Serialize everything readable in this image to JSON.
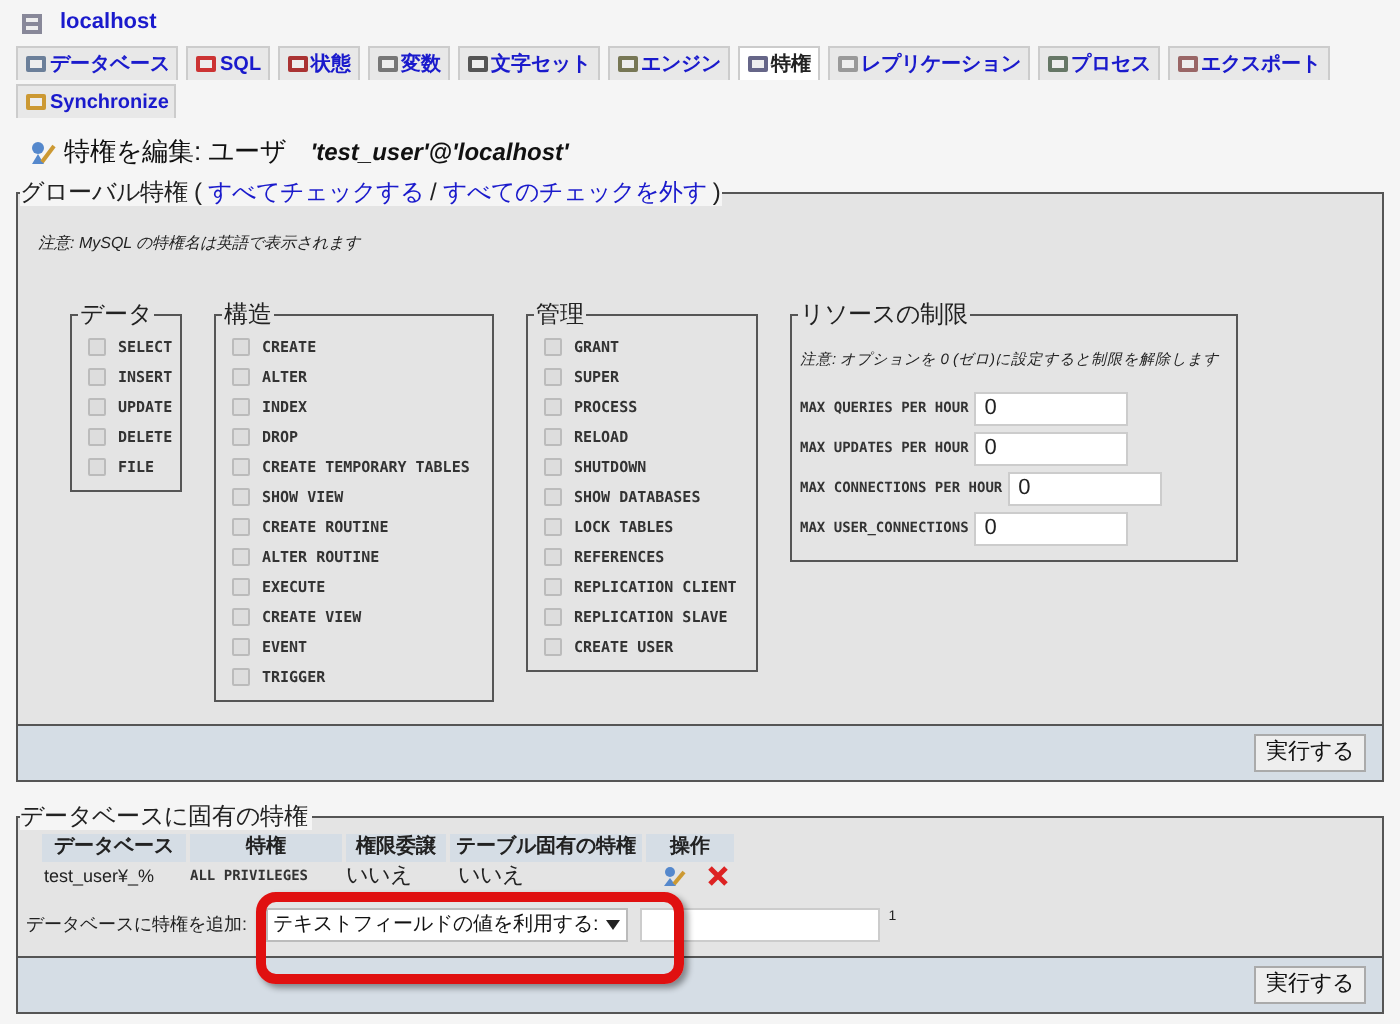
{
  "server": {
    "title": "localhost"
  },
  "tabs": [
    {
      "label": "データベース",
      "selected": false
    },
    {
      "label": "SQL",
      "selected": false
    },
    {
      "label": "状態",
      "selected": false
    },
    {
      "label": "変数",
      "selected": false
    },
    {
      "label": "文字セット",
      "selected": false
    },
    {
      "label": "エンジン",
      "selected": false
    },
    {
      "label": "特権",
      "selected": true
    },
    {
      "label": "レプリケーション",
      "selected": false
    },
    {
      "label": "プロセス",
      "selected": false
    },
    {
      "label": "エクスポート",
      "selected": false
    },
    {
      "label": "Synchronize",
      "selected": false
    }
  ],
  "heading": {
    "label": "特権を編集: ユーザ",
    "user": "'test_user'@'localhost'"
  },
  "global": {
    "legend": "グローバル特権",
    "open_paren": "(",
    "close_paren": ")",
    "check_all": "すべてチェックする",
    "separator": "/",
    "uncheck_all": "すべてのチェックを外す",
    "note": "注意: MySQL の特権名は英語で表示されます",
    "groups": [
      {
        "legend": "データ",
        "items": [
          {
            "label": "SELECT",
            "checked": false
          },
          {
            "label": "INSERT",
            "checked": false
          },
          {
            "label": "UPDATE",
            "checked": false
          },
          {
            "label": "DELETE",
            "checked": false
          },
          {
            "label": "FILE",
            "checked": false
          }
        ]
      },
      {
        "legend": "構造",
        "items": [
          {
            "label": "CREATE",
            "checked": false
          },
          {
            "label": "ALTER",
            "checked": false
          },
          {
            "label": "INDEX",
            "checked": false
          },
          {
            "label": "DROP",
            "checked": false
          },
          {
            "label": "CREATE TEMPORARY TABLES",
            "checked": false
          },
          {
            "label": "SHOW VIEW",
            "checked": false
          },
          {
            "label": "CREATE ROUTINE",
            "checked": false
          },
          {
            "label": "ALTER ROUTINE",
            "checked": false
          },
          {
            "label": "EXECUTE",
            "checked": false
          },
          {
            "label": "CREATE VIEW",
            "checked": false
          },
          {
            "label": "EVENT",
            "checked": false
          },
          {
            "label": "TRIGGER",
            "checked": false
          }
        ]
      },
      {
        "legend": "管理",
        "items": [
          {
            "label": "GRANT",
            "checked": false
          },
          {
            "label": "SUPER",
            "checked": false
          },
          {
            "label": "PROCESS",
            "checked": false
          },
          {
            "label": "RELOAD",
            "checked": false
          },
          {
            "label": "SHUTDOWN",
            "checked": false
          },
          {
            "label": "SHOW DATABASES",
            "checked": false
          },
          {
            "label": "LOCK TABLES",
            "checked": false
          },
          {
            "label": "REFERENCES",
            "checked": false
          },
          {
            "label": "REPLICATION CLIENT",
            "checked": false
          },
          {
            "label": "REPLICATION SLAVE",
            "checked": false
          },
          {
            "label": "CREATE USER",
            "checked": false
          }
        ]
      }
    ],
    "limits": {
      "legend": "リソースの制限",
      "note": "注意: オプションを 0 (ゼロ)に設定すると制限を解除します",
      "fields": [
        {
          "label": "MAX QUERIES PER HOUR",
          "value": "0"
        },
        {
          "label": "MAX UPDATES PER HOUR",
          "value": "0"
        },
        {
          "label": "MAX CONNECTIONS PER HOUR",
          "value": "0"
        },
        {
          "label": "MAX USER_CONNECTIONS",
          "value": "0"
        }
      ]
    },
    "submit": "実行する"
  },
  "database": {
    "legend": "データベースに固有の特権",
    "columns": [
      "データベース",
      "特権",
      "権限委譲",
      "テーブル固有の特権",
      "操作"
    ],
    "rows": [
      {
        "database": "test_user¥_%",
        "privileges": "ALL PRIVILEGES",
        "grant": "いいえ",
        "table_specific": "いいえ"
      }
    ],
    "add_label": "データベースに特権を追加:",
    "select_value": "テキストフィールドの値を利用する:",
    "footnote": "1",
    "submit": "実行する"
  }
}
